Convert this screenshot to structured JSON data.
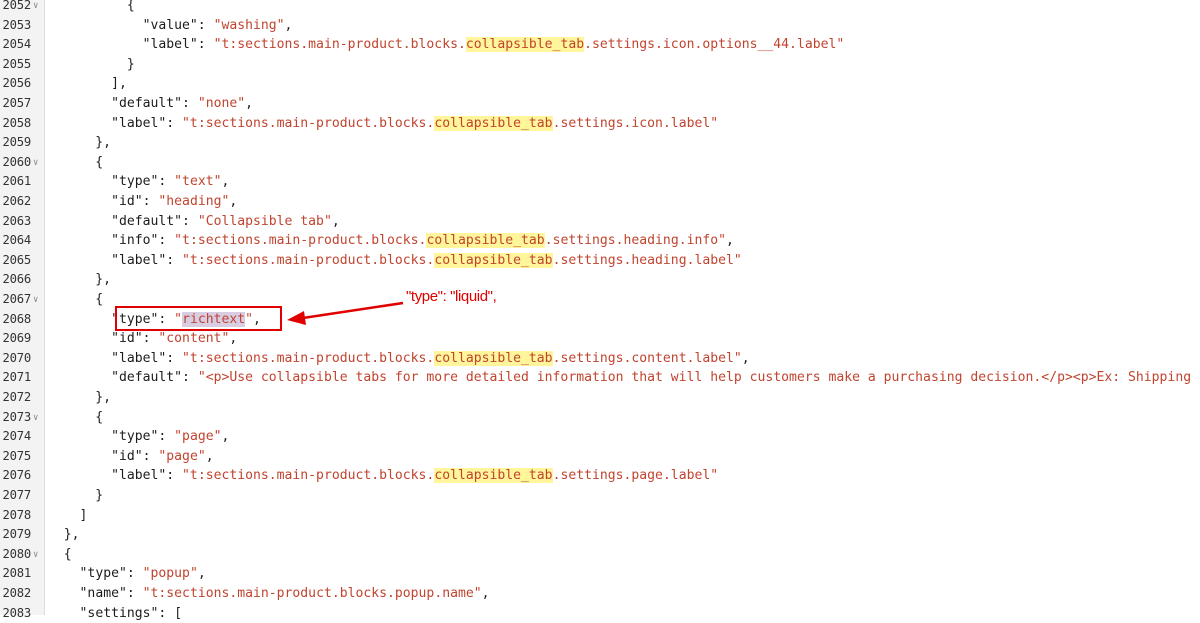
{
  "editor": {
    "lines": [
      {
        "num": "2052",
        "fold": true,
        "tokens": [
          {
            "t": "          {",
            "c": "punc"
          }
        ]
      },
      {
        "num": "2053",
        "fold": false,
        "tokens": [
          {
            "t": "            ",
            "c": "punc"
          },
          {
            "t": "\"value\"",
            "c": "key"
          },
          {
            "t": ": ",
            "c": "punc"
          },
          {
            "t": "\"washing\"",
            "c": "str"
          },
          {
            "t": ",",
            "c": "punc"
          }
        ]
      },
      {
        "num": "2054",
        "fold": false,
        "tokens": [
          {
            "t": "            ",
            "c": "punc"
          },
          {
            "t": "\"label\"",
            "c": "key"
          },
          {
            "t": ": ",
            "c": "punc"
          },
          {
            "t": "\"t:sections.main-product.blocks.",
            "c": "str"
          },
          {
            "t": "collapsible_tab",
            "c": "str",
            "hl": true
          },
          {
            "t": ".settings.icon.options__44.label\"",
            "c": "str"
          }
        ]
      },
      {
        "num": "2055",
        "fold": false,
        "tokens": [
          {
            "t": "          }",
            "c": "punc"
          }
        ]
      },
      {
        "num": "2056",
        "fold": false,
        "tokens": [
          {
            "t": "        ],",
            "c": "punc"
          }
        ]
      },
      {
        "num": "2057",
        "fold": false,
        "tokens": [
          {
            "t": "        ",
            "c": "punc"
          },
          {
            "t": "\"default\"",
            "c": "key"
          },
          {
            "t": ": ",
            "c": "punc"
          },
          {
            "t": "\"none\"",
            "c": "str"
          },
          {
            "t": ",",
            "c": "punc"
          }
        ]
      },
      {
        "num": "2058",
        "fold": false,
        "tokens": [
          {
            "t": "        ",
            "c": "punc"
          },
          {
            "t": "\"label\"",
            "c": "key"
          },
          {
            "t": ": ",
            "c": "punc"
          },
          {
            "t": "\"t:sections.main-product.blocks.",
            "c": "str"
          },
          {
            "t": "collapsible_tab",
            "c": "str",
            "hl": true
          },
          {
            "t": ".settings.icon.label\"",
            "c": "str"
          }
        ]
      },
      {
        "num": "2059",
        "fold": false,
        "tokens": [
          {
            "t": "      },",
            "c": "punc"
          }
        ]
      },
      {
        "num": "2060",
        "fold": true,
        "tokens": [
          {
            "t": "      {",
            "c": "punc"
          }
        ]
      },
      {
        "num": "2061",
        "fold": false,
        "tokens": [
          {
            "t": "        ",
            "c": "punc"
          },
          {
            "t": "\"type\"",
            "c": "key"
          },
          {
            "t": ": ",
            "c": "punc"
          },
          {
            "t": "\"text\"",
            "c": "str"
          },
          {
            "t": ",",
            "c": "punc"
          }
        ]
      },
      {
        "num": "2062",
        "fold": false,
        "tokens": [
          {
            "t": "        ",
            "c": "punc"
          },
          {
            "t": "\"id\"",
            "c": "key"
          },
          {
            "t": ": ",
            "c": "punc"
          },
          {
            "t": "\"heading\"",
            "c": "str"
          },
          {
            "t": ",",
            "c": "punc"
          }
        ]
      },
      {
        "num": "2063",
        "fold": false,
        "tokens": [
          {
            "t": "        ",
            "c": "punc"
          },
          {
            "t": "\"default\"",
            "c": "key"
          },
          {
            "t": ": ",
            "c": "punc"
          },
          {
            "t": "\"Collapsible tab\"",
            "c": "str"
          },
          {
            "t": ",",
            "c": "punc"
          }
        ]
      },
      {
        "num": "2064",
        "fold": false,
        "tokens": [
          {
            "t": "        ",
            "c": "punc"
          },
          {
            "t": "\"info\"",
            "c": "key"
          },
          {
            "t": ": ",
            "c": "punc"
          },
          {
            "t": "\"t:sections.main-product.blocks.",
            "c": "str"
          },
          {
            "t": "collapsible_tab",
            "c": "str",
            "hl": true
          },
          {
            "t": ".settings.heading.info\"",
            "c": "str"
          },
          {
            "t": ",",
            "c": "punc"
          }
        ]
      },
      {
        "num": "2065",
        "fold": false,
        "tokens": [
          {
            "t": "        ",
            "c": "punc"
          },
          {
            "t": "\"label\"",
            "c": "key"
          },
          {
            "t": ": ",
            "c": "punc"
          },
          {
            "t": "\"t:sections.main-product.blocks.",
            "c": "str"
          },
          {
            "t": "collapsible_tab",
            "c": "str",
            "hl": true
          },
          {
            "t": ".settings.heading.label\"",
            "c": "str"
          }
        ]
      },
      {
        "num": "2066",
        "fold": false,
        "tokens": [
          {
            "t": "      },",
            "c": "punc"
          }
        ]
      },
      {
        "num": "2067",
        "fold": true,
        "tokens": [
          {
            "t": "      {",
            "c": "punc"
          }
        ]
      },
      {
        "num": "2068",
        "fold": false,
        "tokens": [
          {
            "t": "        ",
            "c": "punc"
          },
          {
            "t": "\"type\"",
            "c": "key"
          },
          {
            "t": ": ",
            "c": "punc"
          },
          {
            "t": "\"",
            "c": "str"
          },
          {
            "t": "richtext",
            "c": "str",
            "sel": true
          },
          {
            "t": "\"",
            "c": "str"
          },
          {
            "t": ",",
            "c": "punc"
          }
        ]
      },
      {
        "num": "2069",
        "fold": false,
        "tokens": [
          {
            "t": "        ",
            "c": "punc"
          },
          {
            "t": "\"id\"",
            "c": "key"
          },
          {
            "t": ": ",
            "c": "punc"
          },
          {
            "t": "\"content\"",
            "c": "str"
          },
          {
            "t": ",",
            "c": "punc"
          }
        ]
      },
      {
        "num": "2070",
        "fold": false,
        "tokens": [
          {
            "t": "        ",
            "c": "punc"
          },
          {
            "t": "\"label\"",
            "c": "key"
          },
          {
            "t": ": ",
            "c": "punc"
          },
          {
            "t": "\"t:sections.main-product.blocks.",
            "c": "str"
          },
          {
            "t": "collapsible_tab",
            "c": "str",
            "hl": true
          },
          {
            "t": ".settings.content.label\"",
            "c": "str"
          },
          {
            "t": ",",
            "c": "punc"
          }
        ]
      },
      {
        "num": "2071",
        "fold": false,
        "tokens": [
          {
            "t": "        ",
            "c": "punc"
          },
          {
            "t": "\"default\"",
            "c": "key"
          },
          {
            "t": ": ",
            "c": "punc"
          },
          {
            "t": "\"<p>Use collapsible tabs for more detailed information that will help customers make a purchasing decision.</p><p>Ex: Shipping an",
            "c": "str"
          }
        ]
      },
      {
        "num": "2072",
        "fold": false,
        "tokens": [
          {
            "t": "      },",
            "c": "punc"
          }
        ]
      },
      {
        "num": "2073",
        "fold": true,
        "tokens": [
          {
            "t": "      {",
            "c": "punc"
          }
        ]
      },
      {
        "num": "2074",
        "fold": false,
        "tokens": [
          {
            "t": "        ",
            "c": "punc"
          },
          {
            "t": "\"type\"",
            "c": "key"
          },
          {
            "t": ": ",
            "c": "punc"
          },
          {
            "t": "\"page\"",
            "c": "str"
          },
          {
            "t": ",",
            "c": "punc"
          }
        ]
      },
      {
        "num": "2075",
        "fold": false,
        "tokens": [
          {
            "t": "        ",
            "c": "punc"
          },
          {
            "t": "\"id\"",
            "c": "key"
          },
          {
            "t": ": ",
            "c": "punc"
          },
          {
            "t": "\"page\"",
            "c": "str"
          },
          {
            "t": ",",
            "c": "punc"
          }
        ]
      },
      {
        "num": "2076",
        "fold": false,
        "tokens": [
          {
            "t": "        ",
            "c": "punc"
          },
          {
            "t": "\"label\"",
            "c": "key"
          },
          {
            "t": ": ",
            "c": "punc"
          },
          {
            "t": "\"t:sections.main-product.blocks.",
            "c": "str"
          },
          {
            "t": "collapsible_tab",
            "c": "str",
            "hl": true
          },
          {
            "t": ".settings.page.label\"",
            "c": "str"
          }
        ]
      },
      {
        "num": "2077",
        "fold": false,
        "tokens": [
          {
            "t": "      }",
            "c": "punc"
          }
        ]
      },
      {
        "num": "2078",
        "fold": false,
        "tokens": [
          {
            "t": "    ]",
            "c": "punc"
          }
        ]
      },
      {
        "num": "2079",
        "fold": false,
        "tokens": [
          {
            "t": "  },",
            "c": "punc"
          }
        ]
      },
      {
        "num": "2080",
        "fold": true,
        "tokens": [
          {
            "t": "  {",
            "c": "punc"
          }
        ]
      },
      {
        "num": "2081",
        "fold": false,
        "tokens": [
          {
            "t": "    ",
            "c": "punc"
          },
          {
            "t": "\"type\"",
            "c": "key"
          },
          {
            "t": ": ",
            "c": "punc"
          },
          {
            "t": "\"popup\"",
            "c": "str"
          },
          {
            "t": ",",
            "c": "punc"
          }
        ]
      },
      {
        "num": "2082",
        "fold": false,
        "tokens": [
          {
            "t": "    ",
            "c": "punc"
          },
          {
            "t": "\"name\"",
            "c": "key"
          },
          {
            "t": ": ",
            "c": "punc"
          },
          {
            "t": "\"t:sections.main-product.blocks.popup.name\"",
            "c": "str"
          },
          {
            "t": ",",
            "c": "punc"
          }
        ]
      },
      {
        "num": "2083",
        "fold": false,
        "tokens": [
          {
            "t": "    ",
            "c": "punc"
          },
          {
            "t": "\"settings\"",
            "c": "key"
          },
          {
            "t": ": [",
            "c": "punc"
          }
        ]
      }
    ]
  },
  "annotation": {
    "text": "\"type\": \"liquid\",",
    "color": "#e00000"
  },
  "colors": {
    "string": "#c1442f",
    "highlight": "#fff59a",
    "selection": "#d9cde4"
  }
}
